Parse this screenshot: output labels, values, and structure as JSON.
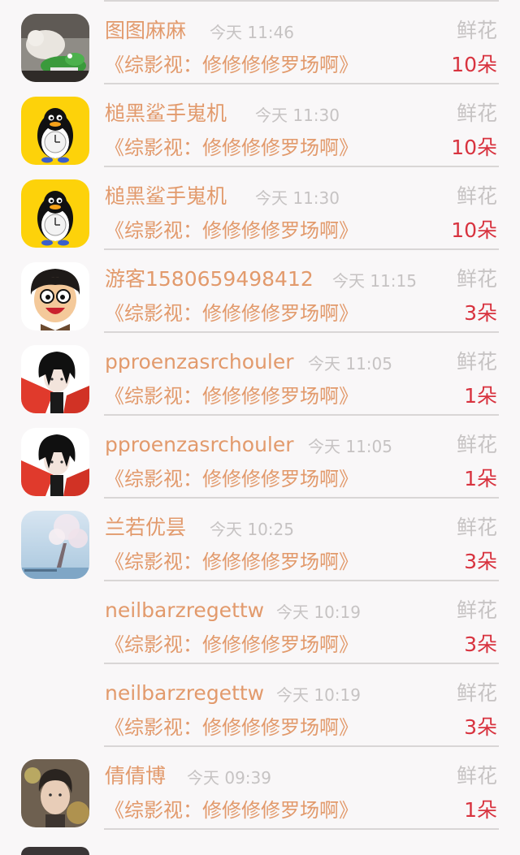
{
  "rows": [
    {
      "name": "图图麻麻",
      "time": "今天 11:46",
      "gift": "鲜花",
      "work": "《综影视：修修修修罗场啊》",
      "count": "10朵",
      "avatar": "crocodile-toy-avatar"
    },
    {
      "name": "槌黑鲨手嵬机",
      "time": "今天 11:30",
      "gift": "鲜花",
      "work": "《综影视：修修修修罗场啊》",
      "count": "10朵",
      "avatar": "penguin-avatar"
    },
    {
      "name": "槌黑鲨手嵬机",
      "time": "今天 11:30",
      "gift": "鲜花",
      "work": "《综影视：修修修修罗场啊》",
      "count": "10朵",
      "avatar": "penguin-avatar"
    },
    {
      "name": "游客1580659498412",
      "time": "今天 11:15",
      "gift": "鲜花",
      "work": "《综影视：修修修修罗场啊》",
      "count": "3朵",
      "avatar": "cartoon-face-avatar"
    },
    {
      "name": "pproenzasrchouler",
      "time": "今天 11:05",
      "gift": "鲜花",
      "work": "《综影视：修修修修罗场啊》",
      "count": "1朵",
      "avatar": "anime-boy-avatar"
    },
    {
      "name": "pproenzasrchouler",
      "time": "今天 11:05",
      "gift": "鲜花",
      "work": "《综影视：修修修修罗场啊》",
      "count": "1朵",
      "avatar": "anime-boy-avatar"
    },
    {
      "name": "兰若优昙",
      "time": "今天 10:25",
      "gift": "鲜花",
      "work": "《综影视：修修修修罗场啊》",
      "count": "3朵",
      "avatar": "cherry-blossom-avatar"
    },
    {
      "name": "neilbarzregettw",
      "time": "今天 10:19",
      "gift": "鲜花",
      "work": "《综影视：修修修修罗场啊》",
      "count": "3朵",
      "avatar": "none"
    },
    {
      "name": "neilbarzregettw",
      "time": "今天 10:19",
      "gift": "鲜花",
      "work": "《综影视：修修修修罗场啊》",
      "count": "3朵",
      "avatar": "none"
    },
    {
      "name": "倩倩博",
      "time": "今天 09:39",
      "gift": "鲜花",
      "work": "《综影视：修修修修罗场啊》",
      "count": "1朵",
      "avatar": "portrait-avatar"
    }
  ],
  "colors": {
    "name": "#e29a6c",
    "meta": "#c6c3c3",
    "count": "#d8333f",
    "divider": "#d9d6d6",
    "background": "#f9f7f8"
  }
}
